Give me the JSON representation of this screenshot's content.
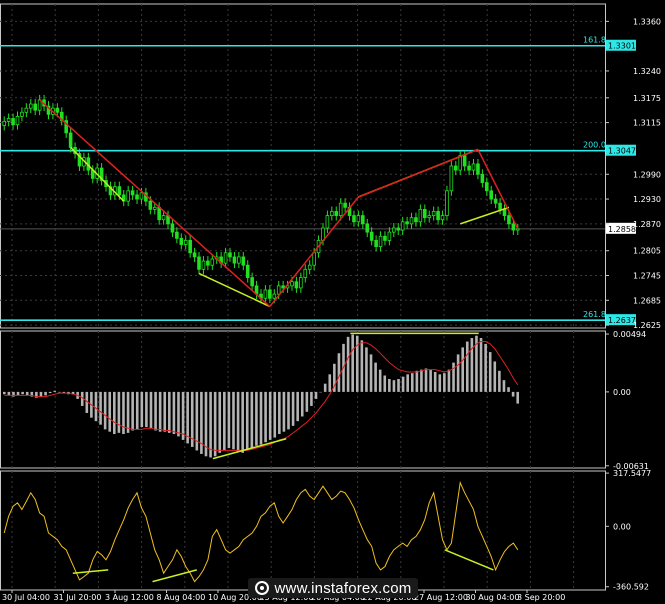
{
  "chart_data": [
    {
      "type": "candlestick",
      "panel": "price",
      "y_ticks": [
        "1.3360",
        "1.3240",
        "1.3175",
        "1.3115",
        "1.2990",
        "1.2930",
        "1.2870",
        "1.2805",
        "1.2745",
        "1.2685",
        "1.2625"
      ],
      "ylim": [
        1.2618,
        1.3402
      ],
      "x_ticks": [
        "30 Jul 04:00",
        "31 Jul 20:00",
        "3 Aug 12:00",
        "8 Aug 04:00",
        "10 Aug 20:00",
        "15 Aug 12:00",
        "20 Aug 04:00",
        "22 Aug 20:00",
        "27 Aug 12:00",
        "30 Aug 04:00",
        "3 Sep 20:00"
      ],
      "closes": [
        1.3118,
        1.3125,
        1.311,
        1.313,
        1.314,
        1.315,
        1.316,
        1.3145,
        1.317,
        1.3155,
        1.3135,
        1.315,
        1.314,
        1.312,
        1.309,
        1.3055,
        1.304,
        1.301,
        1.303,
        1.3,
        1.298,
        1.3005,
        1.2975,
        1.296,
        1.294,
        1.296,
        1.294,
        1.2925,
        1.295,
        1.294,
        1.293,
        1.2945,
        1.2925,
        1.2905,
        1.291,
        1.288,
        1.289,
        1.287,
        1.285,
        1.2835,
        1.282,
        1.283,
        1.28,
        1.279,
        1.276,
        1.278,
        1.277,
        1.2785,
        1.279,
        1.2775,
        1.28,
        1.279,
        1.2775,
        1.279,
        1.277,
        1.274,
        1.272,
        1.27,
        1.269,
        1.271,
        1.269,
        1.27,
        1.272,
        1.2715,
        1.272,
        1.273,
        1.2715,
        1.274,
        1.276,
        1.277,
        1.28,
        1.283,
        1.286,
        1.289,
        1.29,
        1.289,
        1.292,
        1.291,
        1.289,
        1.2875,
        1.289,
        1.287,
        1.285,
        1.283,
        1.2815,
        1.284,
        1.283,
        1.285,
        1.286,
        1.2855,
        1.2875,
        1.287,
        1.2885,
        1.2875,
        1.2905,
        1.2885,
        1.289,
        1.29,
        1.288,
        1.289,
        1.295,
        1.301,
        1.3,
        1.3035,
        1.301,
        1.3,
        1.3015,
        1.299,
        1.297,
        1.295,
        1.293,
        1.292,
        1.2905,
        1.289,
        1.287,
        1.2855,
        1.2858
      ],
      "horizontal_levels": [
        {
          "value": 1.3301,
          "label": "161.8",
          "price_label": "1.3301"
        },
        {
          "value": 1.3047,
          "label": "200.0",
          "price_label": "1.3047"
        },
        {
          "value": 1.2637,
          "label": "261.8",
          "price_label": "1.2637"
        }
      ],
      "current_price": "1.2858"
    },
    {
      "type": "histogram",
      "panel": "macd",
      "y_ticks": [
        "0.00494",
        "0.00",
        "-0.00631"
      ],
      "ylim": [
        -0.0065,
        0.0052
      ],
      "values": [
        -0.0002,
        -0.0003,
        -0.0004,
        -0.0003,
        -0.0002,
        -0.0003,
        -0.0004,
        -0.0005,
        -0.0004,
        -0.0003,
        -0.0001,
        0.0001,
        0.0,
        -0.0001,
        -0.0002,
        -0.0002,
        -0.0006,
        -0.0012,
        -0.0018,
        -0.0022,
        -0.0025,
        -0.0028,
        -0.0032,
        -0.0034,
        -0.0036,
        -0.0035,
        -0.0036,
        -0.0035,
        -0.0033,
        -0.0032,
        -0.003,
        -0.003,
        -0.0031,
        -0.0033,
        -0.0034,
        -0.0034,
        -0.0035,
        -0.0036,
        -0.0038,
        -0.0041,
        -0.0044,
        -0.0047,
        -0.005,
        -0.0053,
        -0.0055,
        -0.0056,
        -0.0055,
        -0.0052,
        -0.005,
        -0.0048,
        -0.0049,
        -0.0051,
        -0.0052,
        -0.005,
        -0.0048,
        -0.0046,
        -0.0045,
        -0.0043,
        -0.0041,
        -0.0039,
        -0.0036,
        -0.0034,
        -0.0032,
        -0.0029,
        -0.0025,
        -0.0021,
        -0.0017,
        -0.0012,
        -0.0006,
        0.0,
        0.0007,
        0.0015,
        0.0024,
        0.0033,
        0.0041,
        0.0047,
        0.0049,
        0.0048,
        0.0044,
        0.0038,
        0.0032,
        0.0025,
        0.0019,
        0.0014,
        0.0011,
        0.001,
        0.0011,
        0.0013,
        0.0015,
        0.0016,
        0.0018,
        0.0019,
        0.002,
        0.0019,
        0.0017,
        0.0015,
        0.0016,
        0.0019,
        0.0025,
        0.0032,
        0.0038,
        0.0043,
        0.0046,
        0.0048,
        0.0046,
        0.0041,
        0.0034,
        0.0026,
        0.0018,
        0.001,
        0.0004,
        -0.0004,
        -0.001
      ],
      "signal": [
        -0.0003,
        -0.0003,
        -0.0003,
        -0.0003,
        -0.0003,
        -0.0003,
        -0.0003,
        -0.0004,
        -0.0004,
        -0.0004,
        -0.0003,
        -0.0002,
        -0.0001,
        -0.0001,
        -0.0001,
        -0.0002,
        -0.0003,
        -0.0005,
        -0.0008,
        -0.0011,
        -0.0014,
        -0.0017,
        -0.002,
        -0.0023,
        -0.0026,
        -0.0028,
        -0.003,
        -0.0031,
        -0.0032,
        -0.0032,
        -0.0032,
        -0.0031,
        -0.0031,
        -0.0032,
        -0.0032,
        -0.0033,
        -0.0033,
        -0.0034,
        -0.0035,
        -0.0036,
        -0.0038,
        -0.004,
        -0.0042,
        -0.0044,
        -0.0047,
        -0.0049,
        -0.005,
        -0.005,
        -0.005,
        -0.005,
        -0.005,
        -0.005,
        -0.005,
        -0.005,
        -0.0049,
        -0.0048,
        -0.0047,
        -0.0046,
        -0.0045,
        -0.0043,
        -0.0041,
        -0.004,
        -0.0038,
        -0.0035,
        -0.0032,
        -0.0029,
        -0.0026,
        -0.0022,
        -0.0018,
        -0.0013,
        -0.0008,
        -0.0002,
        0.0005,
        0.0013,
        0.0021,
        0.0029,
        0.0036,
        0.004,
        0.0042,
        0.0042,
        0.004,
        0.0037,
        0.0033,
        0.0029,
        0.0025,
        0.0022,
        0.0019,
        0.0018,
        0.0017,
        0.0017,
        0.0017,
        0.0018,
        0.0019,
        0.0019,
        0.0019,
        0.0018,
        0.0017,
        0.0018,
        0.002,
        0.0023,
        0.0027,
        0.0032,
        0.0037,
        0.0041,
        0.0043,
        0.0043,
        0.0041,
        0.0037,
        0.0031,
        0.0025,
        0.0019,
        0.0012,
        0.0006
      ]
    },
    {
      "type": "line",
      "panel": "cci",
      "y_ticks": [
        "317.5477",
        "0.00",
        "-360.592"
      ],
      "ylim": [
        -380,
        330
      ],
      "values": [
        -40,
        60,
        120,
        140,
        100,
        150,
        200,
        160,
        80,
        60,
        -40,
        -60,
        -80,
        -120,
        -140,
        -200,
        -260,
        -320,
        -300,
        -280,
        -200,
        -150,
        -170,
        -200,
        -150,
        -80,
        -20,
        40,
        110,
        160,
        200,
        110,
        60,
        -40,
        -140,
        -200,
        -280,
        -240,
        -200,
        -140,
        -180,
        -240,
        -280,
        -330,
        -300,
        -260,
        -200,
        -60,
        -20,
        -80,
        -140,
        -160,
        -140,
        -120,
        -80,
        -60,
        -40,
        0,
        60,
        80,
        120,
        140,
        60,
        20,
        60,
        100,
        160,
        200,
        220,
        180,
        160,
        200,
        240,
        200,
        160,
        180,
        210,
        200,
        160,
        110,
        40,
        -20,
        -80,
        -120,
        -220,
        -260,
        -240,
        -180,
        -140,
        -120,
        -100,
        -120,
        -80,
        -60,
        -20,
        40,
        140,
        200,
        60,
        -80,
        -140,
        -100,
        80,
        260,
        200,
        150,
        100,
        0,
        -60,
        -120,
        -180,
        -260,
        -200,
        -150,
        -120,
        -100,
        -140
      ]
    }
  ]
}
